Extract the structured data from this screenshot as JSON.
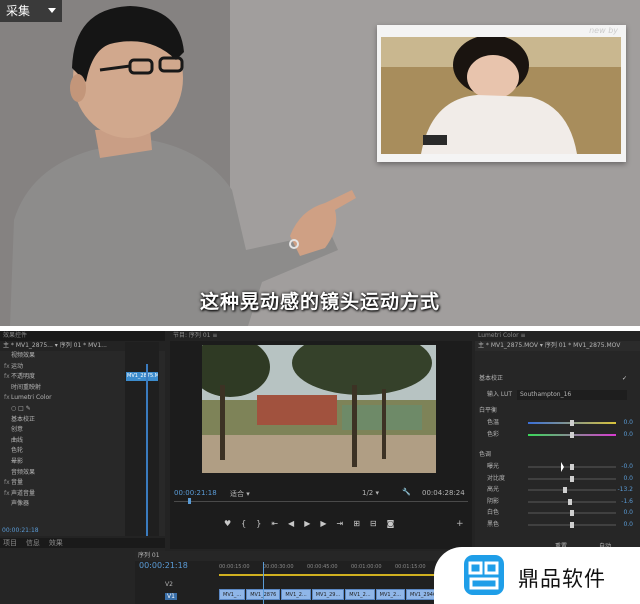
{
  "capture_button": {
    "label": "采集"
  },
  "video": {
    "subtitle": "这种晃动感的镜头运动方式",
    "photo_watermark": "new by"
  },
  "effects_panel": {
    "tabs": "效果控件",
    "source": "主 * MV1_2875... ▾  序列 01 * MV1...",
    "clip_label": "MV1_2875.M",
    "rows": [
      {
        "icon": "",
        "label": "视频效果"
      },
      {
        "icon": "fx",
        "label": "运动"
      },
      {
        "icon": "fx",
        "label": "不透明度"
      },
      {
        "icon": "",
        "label": "时间重映射"
      },
      {
        "icon": "fx",
        "label": "Lumetri Color"
      },
      {
        "icon": "",
        "label": "○ □ ✎"
      },
      {
        "icon": "",
        "label": "基本校正"
      },
      {
        "icon": "",
        "label": "创意"
      },
      {
        "icon": "",
        "label": "曲线"
      },
      {
        "icon": "",
        "label": "色轮"
      },
      {
        "icon": "",
        "label": "晕影"
      },
      {
        "icon": "",
        "label": "音频效果"
      },
      {
        "icon": "fx",
        "label": "音量"
      },
      {
        "icon": "fx",
        "label": "声道音量"
      },
      {
        "icon": "",
        "label": "声像器"
      }
    ],
    "timecode": "00:00:21:18"
  },
  "project_panel": {
    "tabs": [
      "项目",
      "信息",
      "效果"
    ]
  },
  "program_monitor": {
    "title": "节目: 序列 01 ≡",
    "timecode_in": "00:00:21:18",
    "fit": "适合",
    "resolution": "1/2",
    "timecode_out": "00:04:28:24"
  },
  "timeline": {
    "title": "序列 01",
    "timecode": "00:00:21:18",
    "ruler": [
      "00:00:15:00",
      "00:00:30:00",
      "00:00:45:00",
      "00:01:00:00",
      "00:01:15:00",
      "00:01:30:00"
    ],
    "tracks": [
      "V2",
      "V1"
    ],
    "clips": [
      "MV1_...",
      "MV1_2876",
      "MV1_2...",
      "MV1_29...",
      "MV1_2...",
      "MV1_2...",
      "MV1_2946.MOV"
    ]
  },
  "lumetri": {
    "title": "Lumetri Color ≡",
    "source": "主 * MV1_2875.MOV ▾  序列 01 * MV1_2875.MOV",
    "section": "基本校正",
    "input_lut_label": "输入 LUT",
    "input_lut_value": "Southampton_16",
    "white_balance": "白平衡",
    "tone": "色调",
    "sliders": [
      {
        "label": "色温",
        "value": "0.0",
        "pos": 0.5
      },
      {
        "label": "色彩",
        "value": "0.0",
        "pos": 0.5
      },
      {
        "label": "曝光",
        "value": "-0.0",
        "pos": 0.5
      },
      {
        "label": "对比度",
        "value": "0.0",
        "pos": 0.5
      },
      {
        "label": "高光",
        "value": "-13.2",
        "pos": 0.42
      },
      {
        "label": "阴影",
        "value": "-1.6",
        "pos": 0.48
      },
      {
        "label": "白色",
        "value": "0.0",
        "pos": 0.5
      },
      {
        "label": "黑色",
        "value": "0.0",
        "pos": 0.5
      }
    ],
    "reset": "重置",
    "auto": "自动"
  },
  "brand": {
    "name": "鼎品软件",
    "color": "#1f9ee8"
  }
}
